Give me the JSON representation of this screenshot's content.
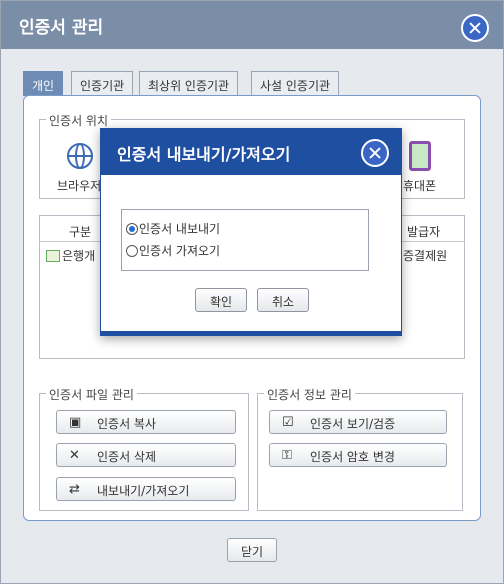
{
  "window": {
    "title": "인증서 관리"
  },
  "tabs": [
    {
      "label": "개인",
      "active": true
    },
    {
      "label": "인증기관",
      "active": false
    },
    {
      "label": "최상위 인증기관",
      "active": false
    },
    {
      "label": "사설 인증기관",
      "active": false
    }
  ],
  "location": {
    "legend": "인증서 위치",
    "items": [
      {
        "label": "브라우저",
        "icon": "globe-icon"
      },
      {
        "label": "휴대폰",
        "icon": "phone-icon"
      }
    ]
  },
  "table": {
    "columns": [
      "구분",
      "발급자"
    ],
    "rows": [
      {
        "type": "은행개",
        "issuer": "증결제원"
      }
    ]
  },
  "file_management": {
    "legend": "인증서 파일 관리",
    "buttons": [
      {
        "label": "인증서 복사",
        "icon": "floppy-icon"
      },
      {
        "label": "인증서 삭제",
        "icon": "x-icon"
      },
      {
        "label": "내보내기/가져오기",
        "icon": "export-icon"
      }
    ]
  },
  "info_management": {
    "legend": "인증서 정보 관리",
    "buttons": [
      {
        "label": "인증서 보기/검증",
        "icon": "cert-view-icon"
      },
      {
        "label": "인증서 암호 변경",
        "icon": "password-icon"
      }
    ]
  },
  "footer": {
    "close_label": "닫기"
  },
  "dialog": {
    "title": "인증서 내보내기/가져오기",
    "options": [
      {
        "label": "인증서 내보내기",
        "selected": true
      },
      {
        "label": "인증서 가져오기",
        "selected": false
      }
    ],
    "confirm_label": "확인",
    "cancel_label": "취소"
  },
  "colors": {
    "titlebar": "#7b8ea8",
    "dialog_title": "#1f4fa0",
    "accent": "#3a66c4",
    "active_tab": "#6d8bb5"
  }
}
